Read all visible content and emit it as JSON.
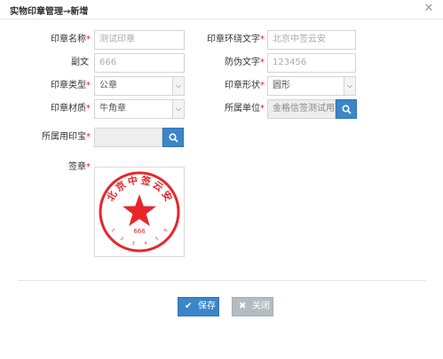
{
  "dialog": {
    "title": "实物印章管理→新增",
    "close_glyph": "✕"
  },
  "form": {
    "seal_name": {
      "label": "印章名称",
      "required": "*",
      "value": "测试印章"
    },
    "ring_text": {
      "label": "印章环绕文字",
      "required": "*",
      "value": "北京中签云安"
    },
    "sub_text": {
      "label": "副文",
      "value": "666"
    },
    "anti_fake_text": {
      "label": "防伪文字",
      "required": "*",
      "value": "123456"
    },
    "seal_type": {
      "label": "印章类型",
      "required": "*",
      "value": "公章"
    },
    "seal_shape": {
      "label": "印章形状",
      "required": "*",
      "value": "圆形"
    },
    "seal_material": {
      "label": "印章材质",
      "required": "*",
      "value": "牛角章"
    },
    "unit": {
      "label": "所属单位",
      "required": "*",
      "value": "金格信签测试用户"
    },
    "seal_owner": {
      "label": "所属用印宝",
      "required": "*",
      "value": ""
    },
    "signature": {
      "label": "签章",
      "required": "*"
    }
  },
  "stamp": {
    "ring_chars": [
      "北",
      "京",
      "中",
      "签",
      "云",
      "安"
    ],
    "sub_text": "666",
    "anti_fake_digits": [
      "1",
      "2",
      "3",
      "4",
      "5",
      "6"
    ],
    "color": "#e8262a"
  },
  "buttons": {
    "save": {
      "label": "保存",
      "icon": "✔"
    },
    "close": {
      "label": "关闭",
      "icon": "✖"
    }
  },
  "colors": {
    "primary": "#3a86c8",
    "required": "#e02020",
    "disabled_button": "#b4bcc2"
  }
}
